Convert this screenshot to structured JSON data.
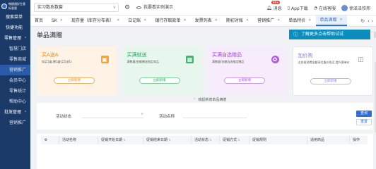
{
  "logo": {
    "text": "畅捷通好生意",
    "sub": "标准版"
  },
  "sidebar": {
    "items": [
      {
        "label": "搜索菜单",
        "kind": "item"
      },
      {
        "label": "快捷功能",
        "kind": "item"
      },
      {
        "label": "零售管理",
        "kind": "group",
        "arrow": "⌃"
      },
      {
        "label": "智慧门店",
        "kind": "sub"
      },
      {
        "label": "零售商城",
        "kind": "sub"
      },
      {
        "label": "营销推广",
        "kind": "sub",
        "active": true
      },
      {
        "label": "会员中心",
        "kind": "sub"
      },
      {
        "label": "零售统计",
        "kind": "sub"
      },
      {
        "label": "帮助中心",
        "kind": "sub"
      },
      {
        "label": "批发管理",
        "kind": "group",
        "arrow": "⌃"
      },
      {
        "label": "营销推广",
        "kind": "sub"
      }
    ]
  },
  "topbar": {
    "store": "实习数系数套",
    "store_chevron": "∨",
    "gear_icon": "⚙",
    "intro": "我要看实例演示",
    "msg_label": "消息",
    "msg_badge": "99+",
    "app_label": "App下载",
    "service_label": "在线客服",
    "user": "徐泽泽铁邦"
  },
  "tabs": [
    {
      "label": "首页",
      "closable": false
    },
    {
      "label": "SK",
      "closable": true
    },
    {
      "label": "现存量（库存分布表）",
      "closable": true
    },
    {
      "label": "日记账",
      "closable": true
    },
    {
      "label": "银行存取款单",
      "closable": true
    },
    {
      "label": "发票列表",
      "closable": true
    },
    {
      "label": "期初对账",
      "closable": true
    },
    {
      "label": "营销推广",
      "closable": true
    },
    {
      "label": "单品特价",
      "closable": true
    },
    {
      "label": "单品满赠",
      "closable": true,
      "active": true
    }
  ],
  "tabs_end": {
    "refresh": "↻",
    "more": "‹ ›"
  },
  "page": {
    "title": "单品满赠"
  },
  "toast": {
    "icon": "ⓘ",
    "text": "了解更多点击帮助试试"
  },
  "cards": [
    {
      "title": "买A送A",
      "desc": "如买1盒,赠1盒(买5送1)",
      "button": "立即新增",
      "icon": "▣"
    },
    {
      "title": "买满就送",
      "desc": "满数量/金额赠送指定商品",
      "button": "立即新增",
      "icon": "▦"
    },
    {
      "title": "买满自选赠品",
      "desc": "满数量/金额自选指定赠品",
      "button": "立即新增",
      "icon": "✿"
    },
    {
      "title": "加价购",
      "desc": "达合规消费金额享优惠价购买,提升客单价",
      "button": "立即新增",
      "icon": "◫"
    }
  ],
  "collapse": {
    "icon": "⌃",
    "text": "收起新增单品满赠"
  },
  "filters": [
    {
      "label": "活动状态",
      "value": "",
      "chevron": "∨"
    },
    {
      "label": "活动名称",
      "value": "",
      "chevron": ""
    }
  ],
  "buttons": {
    "query": "查询",
    "reset": "重置"
  },
  "table": {
    "settings_icon": "⚙",
    "columns": [
      "活动名称",
      "促销开始日期",
      "促销结束日期",
      "活动状态",
      "促销方式",
      "促销规则",
      "适用商品",
      "操作"
    ]
  }
}
